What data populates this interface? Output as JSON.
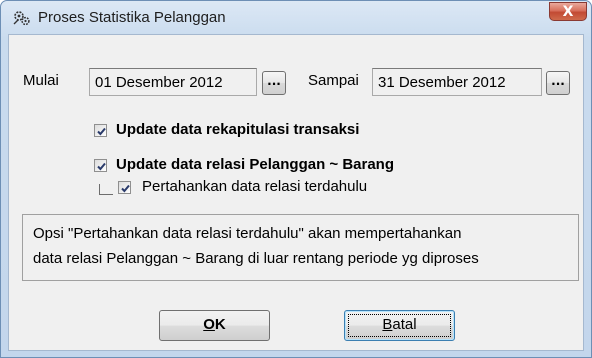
{
  "window": {
    "title": "Proses Statistika Pelanggan",
    "close_label": "X",
    "app_icon": "gears-icon"
  },
  "period": {
    "start_label": "Mulai",
    "start_value": "01 Desember 2012",
    "end_label": "Sampai",
    "end_value": "31 Desember 2012",
    "browse_label": "..."
  },
  "options": {
    "rekap_label": "Update data rekapitulasi transaksi",
    "rekap_checked": true,
    "relasi_label": "Update data relasi Pelanggan ~ Barang",
    "relasi_checked": true,
    "keep_label": "Pertahankan data relasi terdahulu",
    "keep_checked": true
  },
  "note": {
    "line1": "Opsi \"Pertahankan data relasi terdahulu\" akan mempertahankan",
    "line2": "data relasi Pelanggan ~ Barang di luar rentang periode yg diproses"
  },
  "buttons": {
    "ok_hotkey": "O",
    "ok_rest": "K",
    "cancel_hotkey": "B",
    "cancel_rest": "atal"
  },
  "colors": {
    "close_red": "#c24a33",
    "check_blue": "#2a3b6b",
    "title_gradient_top": "#dce8f5"
  }
}
